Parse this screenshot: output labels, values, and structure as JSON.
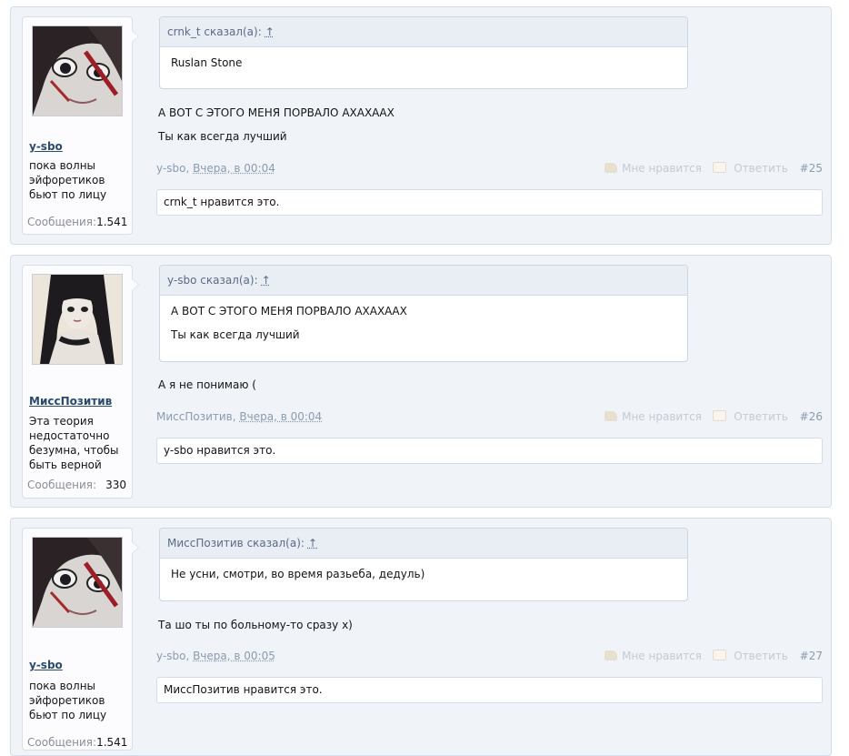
{
  "posts": [
    {
      "user": {
        "name": "y-sbo",
        "title": "пока волны эйфоретиков бьют по лицу",
        "messages_label": "Сообщения:",
        "messages_count": "1.541",
        "avatar": "avatar-girl-bandage"
      },
      "quote": {
        "header": "crnk_t сказал(а):",
        "arrow": "↑",
        "lines": [
          "Ruslan Stone"
        ]
      },
      "text": [
        "А ВОТ С ЭТОГО МЕНЯ ПОРВАЛО АХАХААХ",
        "Ты как всегда лучший"
      ],
      "author": "y-sbo",
      "sep": ", ",
      "date": "Вчера, в 00:04",
      "like_label": "Мне нравится",
      "reply_label": "Ответить",
      "number": "#25",
      "likes_text": "crnk_t нравится это."
    },
    {
      "user": {
        "name": "МиссПозитив",
        "title": "Эта теория недостаточно безумна, чтобы быть верной",
        "messages_label": "Сообщения:",
        "messages_count": "330",
        "avatar": "avatar-dark-hair-girl"
      },
      "quote": {
        "header": "y-sbo сказал(а):",
        "arrow": "↑",
        "lines": [
          "А ВОТ С ЭТОГО МЕНЯ ПОРВАЛО АХАХААХ",
          "Ты как всегда лучший"
        ]
      },
      "text": [
        "А я не понимаю ("
      ],
      "author": "МиссПозитив",
      "sep": ", ",
      "date": "Вчера, в 00:04",
      "like_label": "Мне нравится",
      "reply_label": "Ответить",
      "number": "#26",
      "likes_text": "y-sbo нравится это."
    },
    {
      "user": {
        "name": "y-sbo",
        "title": "пока волны эйфоретиков бьют по лицу",
        "messages_label": "Сообщения:",
        "messages_count": "1.541",
        "avatar": "avatar-girl-bandage"
      },
      "quote": {
        "header": "МиссПозитив сказал(а):",
        "arrow": "↑",
        "lines": [
          "Не усни, смотри, во время разьеба, дедуль)"
        ]
      },
      "text": [
        "Та шо ты по больному-то сразу х)"
      ],
      "author": "y-sbo",
      "sep": ", ",
      "date": "Вчера, в 00:05",
      "like_label": "Мне нравится",
      "reply_label": "Ответить",
      "number": "#27",
      "likes_text": "МиссПозитив нравится это."
    }
  ]
}
